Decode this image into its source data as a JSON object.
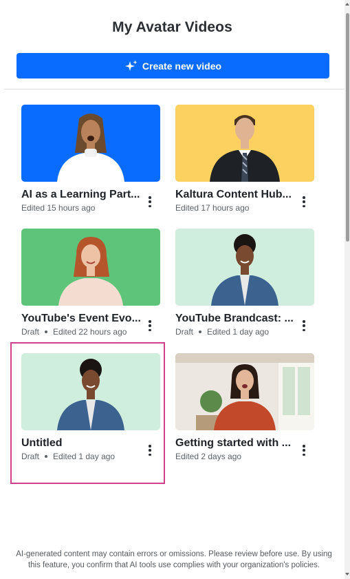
{
  "header": {
    "title": "My Avatar Videos"
  },
  "create_button": {
    "label": "Create new video",
    "icon": "sparkle-icon",
    "color": "#0a6cff"
  },
  "videos": [
    {
      "title": "AI as a Learning Part...",
      "status": "",
      "edited": "Edited 15 hours ago",
      "thumb_bg": "#0a6cff"
    },
    {
      "title": "Kaltura Content Hub...",
      "status": "",
      "edited": "Edited 17 hours ago",
      "thumb_bg": "#fdd160"
    },
    {
      "title": "YouTube's Event Evo...",
      "status": "Draft",
      "edited": "Edited 22 hours ago",
      "thumb_bg": "#5ec47a"
    },
    {
      "title": "YouTube Brandcast: ...",
      "status": "Draft",
      "edited": "Edited 1 day ago",
      "thumb_bg": "#cfeedd"
    },
    {
      "title": "Untitled",
      "status": "Draft",
      "edited": "Edited 1 day ago",
      "thumb_bg": "#cfeedd",
      "selected": true
    },
    {
      "title": "Getting started with ...",
      "status": "",
      "edited": "Edited 2 days ago",
      "thumb_bg": "#ece7e0"
    }
  ],
  "footer": {
    "line1": "AI-generated content may contain errors or omissions. Please review before use. By using",
    "line2": "this feature, you confirm that AI tools use complies with your organization's policies."
  },
  "colors": {
    "selection": "#d3408a",
    "accent": "#0a6cff"
  }
}
